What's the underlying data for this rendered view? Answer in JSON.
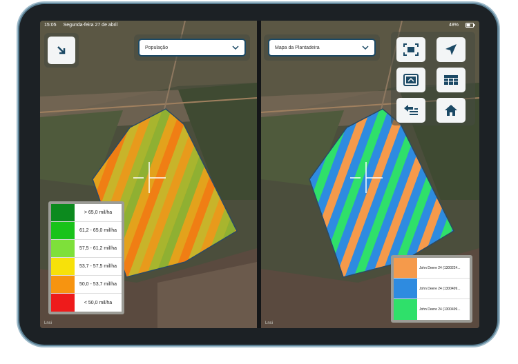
{
  "status": {
    "time": "15:05",
    "date": "Segunda-feira 27 de abril",
    "battery": "48%"
  },
  "left_panel": {
    "dropdown_value": "População",
    "legend": [
      {
        "label": "> 65,0 mil/ha",
        "color": "#0c8a1e"
      },
      {
        "label": "61,2 - 65,0 mil/ha",
        "color": "#19c31a"
      },
      {
        "label": "57,5 - 61,2 mil/ha",
        "color": "#7ee03a"
      },
      {
        "label": "53,7 - 57,5 mil/ha",
        "color": "#f7e10a"
      },
      {
        "label": "50,0 - 53,7 mil/ha",
        "color": "#f79410"
      },
      {
        "label": "< 50,0 mil/ha",
        "color": "#ee1b1b"
      }
    ],
    "footer": "Lnsi"
  },
  "right_panel": {
    "dropdown_value": "Mapa da Plantadeira",
    "legend": [
      {
        "label": "John Deere 24 (1300224...",
        "color": "#f59a4b"
      },
      {
        "label": "John Deere 24 (1300499...",
        "color": "#2e8be0"
      },
      {
        "label": "John Deere 24 (1300499...",
        "color": "#2fe06a"
      }
    ],
    "footer": "Lnsi"
  },
  "icons": {
    "collapse": "arrow-down-right-icon",
    "fit": "fit-screen-icon",
    "locate": "navigation-arrow-icon",
    "picture": "picture-in-picture-icon",
    "table": "table-icon",
    "back": "list-back-icon",
    "home": "home-icon"
  },
  "colors": {
    "accent": "#1b4965",
    "button_bg": "#f3f5f6"
  }
}
